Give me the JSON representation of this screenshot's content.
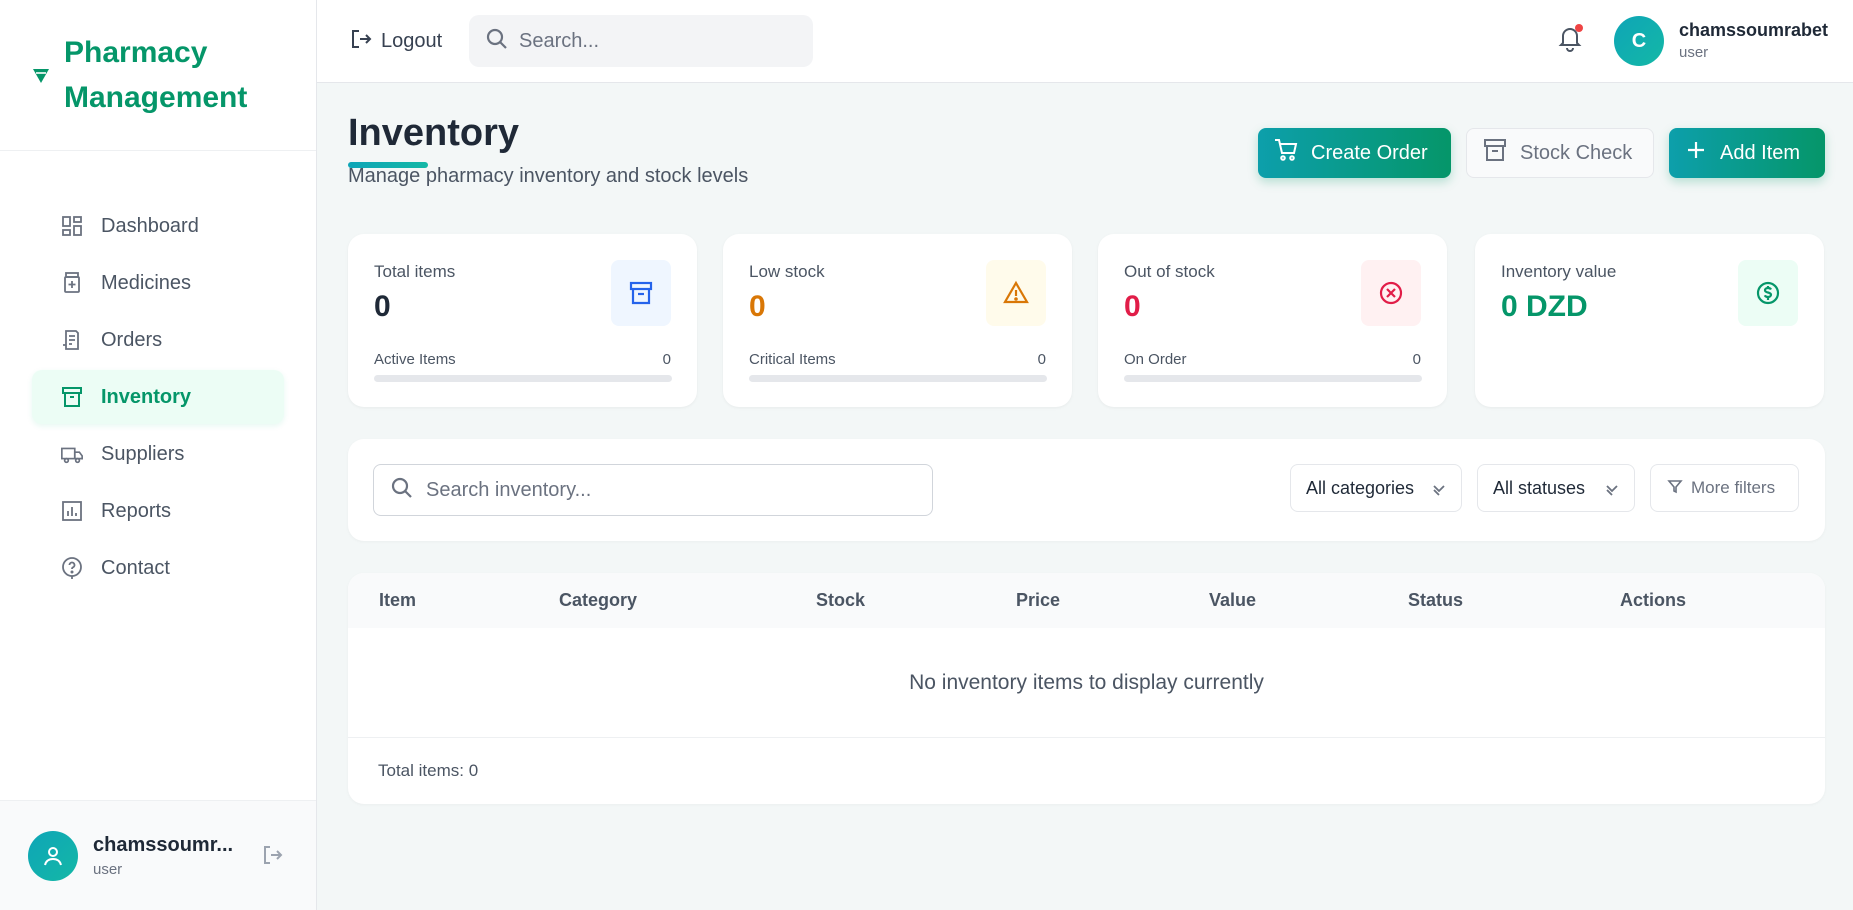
{
  "brand": {
    "title_line1": "Pharmacy",
    "title_line2": "Management"
  },
  "sidebar": {
    "items": [
      {
        "label": "Dashboard",
        "icon": "dashboard-icon"
      },
      {
        "label": "Medicines",
        "icon": "medicine-icon"
      },
      {
        "label": "Orders",
        "icon": "orders-icon"
      },
      {
        "label": "Inventory",
        "icon": "inventory-icon",
        "active": true
      },
      {
        "label": "Suppliers",
        "icon": "truck-icon"
      },
      {
        "label": "Reports",
        "icon": "reports-icon"
      },
      {
        "label": "Contact",
        "icon": "help-icon"
      }
    ],
    "user": {
      "name": "chamssoumr...",
      "role": "user"
    }
  },
  "topbar": {
    "logout_label": "Logout",
    "search_placeholder": "Search...",
    "avatar_initial": "C",
    "user_name": "chamssoumrabet",
    "user_role": "user"
  },
  "page": {
    "title": "Inventory",
    "subtitle": "Manage pharmacy inventory and stock levels",
    "buttons": {
      "create_order": "Create Order",
      "stock_check": "Stock Check",
      "add_item": "Add Item"
    }
  },
  "stats": [
    {
      "label": "Total items",
      "value": "0",
      "foot_label": "Active Items",
      "foot_count": "0",
      "progress": 0,
      "color": "#1f2937",
      "icon_bg": "#eff6ff",
      "icon_color": "#2563eb"
    },
    {
      "label": "Low stock",
      "value": "0",
      "foot_label": "Critical Items",
      "foot_count": "0",
      "progress": 0,
      "color": "#d97706",
      "icon_bg": "#fffbeb",
      "icon_color": "#d97706"
    },
    {
      "label": "Out of stock",
      "value": "0",
      "foot_label": "On Order",
      "foot_count": "0",
      "progress": 0,
      "color": "#e11d48",
      "icon_bg": "#fff1f2",
      "icon_color": "#e11d48"
    },
    {
      "label": "Inventory value",
      "value": "0 DZD",
      "color": "#059669",
      "icon_bg": "#ecfdf5",
      "icon_color": "#059669"
    }
  ],
  "filters": {
    "search_placeholder": "Search inventory...",
    "category_selected": "All categories",
    "status_selected": "All statuses",
    "more_filters_label": "More filters"
  },
  "table": {
    "columns": [
      "Item",
      "Category",
      "Stock",
      "Price",
      "Value",
      "Status",
      "Actions"
    ],
    "empty_message": "No inventory items to display currently",
    "footer": "Total items: 0"
  }
}
